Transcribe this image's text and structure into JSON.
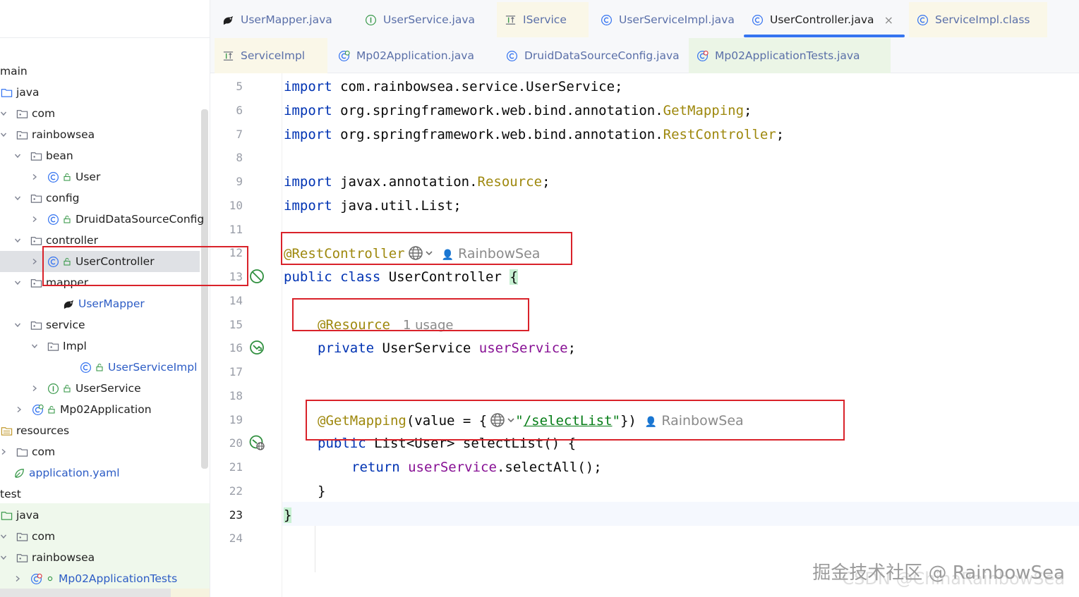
{
  "project_tree": {
    "rows": [
      {
        "label": "main",
        "icon": "none"
      },
      {
        "label": "java",
        "icon": "source-folder-icon"
      },
      {
        "label": "com",
        "icon": "package-folder-icon"
      },
      {
        "label": "rainbowsea",
        "icon": "package-folder-icon"
      },
      {
        "label": "bean",
        "icon": "package-folder-icon"
      },
      {
        "label": "User",
        "icon": "class-icon"
      },
      {
        "label": "config",
        "icon": "package-folder-icon"
      },
      {
        "label": "DruidDataSourceConfig",
        "icon": "class-icon"
      },
      {
        "label": "controller",
        "icon": "package-folder-icon"
      },
      {
        "label": "UserController",
        "icon": "class-icon"
      },
      {
        "label": "mapper",
        "icon": "package-folder-icon"
      },
      {
        "label": "UserMapper",
        "icon": "mybatis-bird-icon"
      },
      {
        "label": "service",
        "icon": "package-folder-icon"
      },
      {
        "label": "Impl",
        "icon": "package-folder-icon"
      },
      {
        "label": "UserServiceImpl",
        "icon": "class-icon"
      },
      {
        "label": "UserService",
        "icon": "interface-icon"
      },
      {
        "label": "Mp02Application",
        "icon": "spring-boot-class-icon"
      },
      {
        "label": "resources",
        "icon": "resources-folder-icon"
      },
      {
        "label": "com",
        "icon": "folder-icon"
      },
      {
        "label": "application.yaml",
        "icon": "spring-config-icon"
      },
      {
        "label": "test",
        "icon": "none"
      },
      {
        "label": "java",
        "icon": "test-source-folder-icon"
      },
      {
        "label": "com",
        "icon": "package-folder-icon"
      },
      {
        "label": "rainbowsea",
        "icon": "package-folder-icon"
      },
      {
        "label": "Mp02ApplicationTests",
        "icon": "spring-test-class-icon"
      }
    ]
  },
  "tabs": {
    "row1": [
      {
        "label": "UserMapper.java",
        "icon": "mybatis-bird-icon"
      },
      {
        "label": "UserService.java",
        "icon": "interface-icon"
      },
      {
        "label": "IService",
        "icon": "interface-decompiled-icon"
      },
      {
        "label": "UserServiceImpl.java",
        "icon": "class-icon"
      },
      {
        "label": "UserController.java",
        "icon": "class-icon",
        "close": "×"
      },
      {
        "label": "ServiceImpl.class",
        "icon": "class-icon"
      }
    ],
    "row2": [
      {
        "label": "ServiceImpl",
        "icon": "interface-decompiled-icon"
      },
      {
        "label": "Mp02Application.java",
        "icon": "spring-boot-class-icon"
      },
      {
        "label": "DruidDataSourceConfig.java",
        "icon": "class-icon"
      },
      {
        "label": "Mp02ApplicationTests.java",
        "icon": "spring-test-class-icon"
      }
    ]
  },
  "editor": {
    "line_numbers": [
      "5",
      "6",
      "7",
      "8",
      "9",
      "10",
      "11",
      "12",
      "13",
      "14",
      "15",
      "16",
      "17",
      "18",
      "19",
      "20",
      "21",
      "22",
      "23",
      "24"
    ],
    "current_line": "23",
    "code": {
      "l5_kw": "import",
      "l5_rest": " com.rainbowsea.service.UserService;",
      "l6_kw": "import",
      "l6_pkg": " org.springframework.web.bind.annotation.",
      "l6_ann": "GetMapping",
      "l6_end": ";",
      "l7_kw": "import",
      "l7_pkg": " org.springframework.web.bind.annotation.",
      "l7_ann": "RestController",
      "l7_end": ";",
      "l9_kw": "import",
      "l9_pkg": " javax.annotation.",
      "l9_ann": "Resource",
      "l9_end": ";",
      "l10_kw": "import",
      "l10_rest": " java.util.List;",
      "l12_ann": "@RestController",
      "l12_author": "RainbowSea",
      "l13_kw1": "public",
      "l13_kw2": "class",
      "l13_name": " UserController ",
      "l13_brace": "{",
      "l15_ann": "@Resource",
      "l15_usage": "1 usage",
      "l16_kw": "private",
      "l16_type": " UserService ",
      "l16_field": "userService",
      "l16_end": ";",
      "l19_ann": "@GetMapping",
      "l19_args": "(value = {",
      "l19_str_q1": "\"",
      "l19_str": "/selectList",
      "l19_str_q2": "\"",
      "l19_end": "})",
      "l19_author": "RainbowSea",
      "l20_kw": "public",
      "l20_rest": " List<User> selectList() {",
      "l21_kw": "return",
      "l21_field": "userService",
      "l21_rest": ".selectAll();",
      "l22_text": "}",
      "l23_text": "}"
    }
  },
  "watermark": {
    "line1": "掘金技术社区 @ RainbowSea",
    "line2": "CSDN @ChinaRainbowSea"
  },
  "colors": {
    "keyword": "#0033b3",
    "annotation": "#9e880d",
    "field": "#871094",
    "string": "#067d17",
    "annotation_box": "#d9222a",
    "active_tab_underline": "#3574f0"
  }
}
